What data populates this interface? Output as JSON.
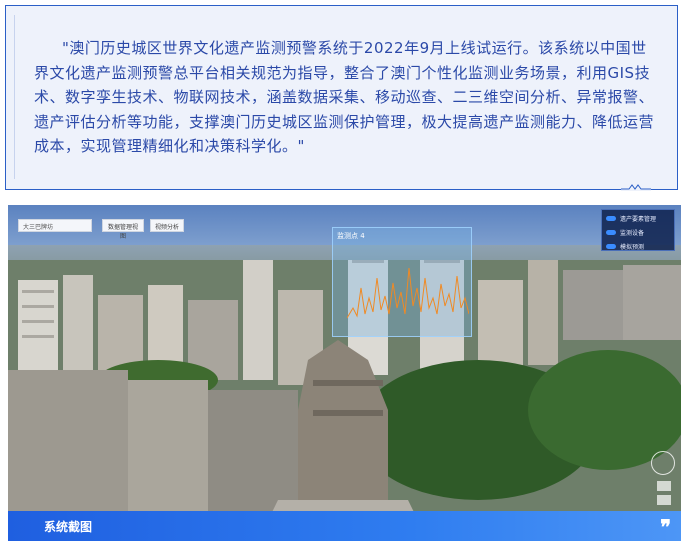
{
  "quote": {
    "text": "\"澳门历史城区世界文化遗产监测预警系统于2022年9月上线试运行。该系统以中国世界文化遗产监测预警总平台相关规范为指导，整合了澳门个性化监测业务场景，利用GIS技术、数字孪生技术、物联网技术，涵盖数据采集、移动巡查、二三维空间分析、异常报警、遗产评估分析等功能，支撑澳门历史城区监测保护管理，极大提高遗产监测能力、降低运营成本，实现管理精细化和决策科学化。\""
  },
  "screenshot": {
    "select_label": "大三巴牌坊",
    "buttons": [
      "数据管理视图",
      "视频分析"
    ],
    "panel_items": [
      "遗产要素管理",
      "监测设备",
      "模拟预测"
    ],
    "float_panel_title": "监测点 4",
    "caption": "系统截图",
    "quote_mark": "❞"
  },
  "colors": {
    "accent": "#2b5fc7",
    "text_blue": "#2b49a8",
    "caption_bar": "#1f5fe0"
  }
}
